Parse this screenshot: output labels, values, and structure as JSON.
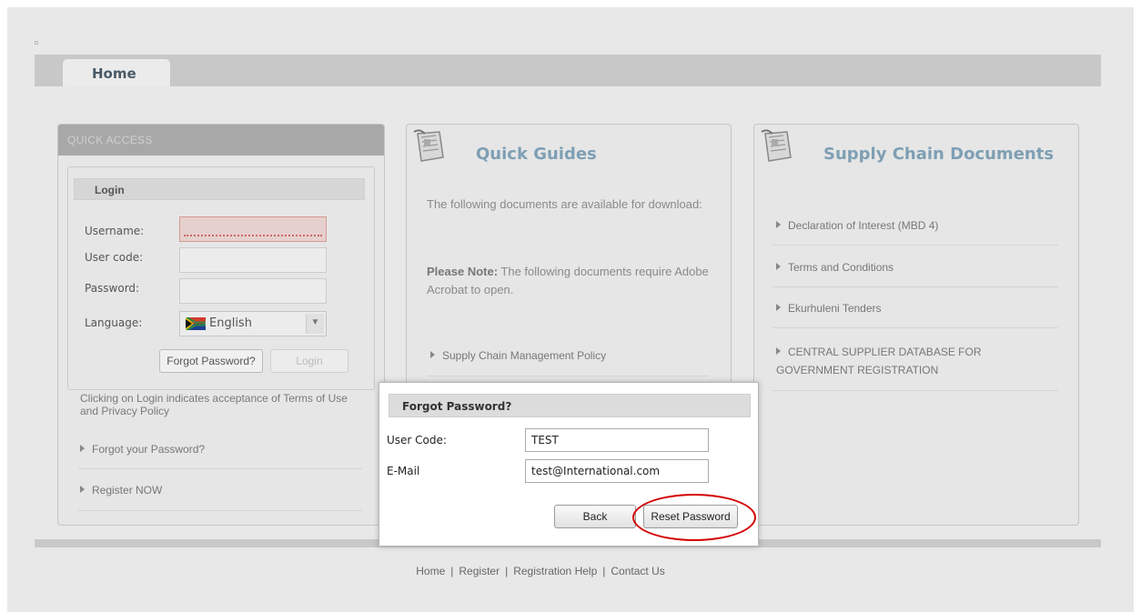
{
  "nav": {
    "tab_home": "Home"
  },
  "quick_access": {
    "header": "QUICK ACCESS",
    "login": {
      "title": "Login",
      "username_label": "Username:",
      "usercode_label": "User code:",
      "password_label": "Password:",
      "language_label": "Language:",
      "language_value": "English",
      "forgot_button": "Forgot Password?",
      "login_button": "Login"
    },
    "terms_text": "Clicking on Login indicates acceptance of Terms of Use and Privacy Policy",
    "links": [
      "Forgot your Password?",
      "Register NOW"
    ]
  },
  "quick_guides": {
    "title": "Quick Guides",
    "intro": "The following documents are available for download:",
    "note_label": "Please Note:",
    "note_text": " The following documents require Adobe Acrobat to open.",
    "links": [
      "Supply Chain Management Policy"
    ]
  },
  "supply_chain": {
    "title": "Supply Chain Documents",
    "links": [
      "Declaration of Interest (MBD 4)",
      "Terms and Conditions",
      "Ekurhuleni Tenders",
      "CENTRAL SUPPLIER DATABASE FOR GOVERNMENT REGISTRATION"
    ]
  },
  "footer": {
    "links": [
      "Home",
      "Register",
      "Registration Help",
      "Contact Us"
    ],
    "separator": "|"
  },
  "modal": {
    "title": "Forgot Password?",
    "usercode_label": "User Code:",
    "usercode_value": "TEST",
    "email_label": "E-Mail",
    "email_value": "test@International.com",
    "back_button": "Back",
    "reset_button": "Reset Password"
  },
  "colors": {
    "accent_title": "#7e9fb4",
    "highlight": "#d40000"
  }
}
